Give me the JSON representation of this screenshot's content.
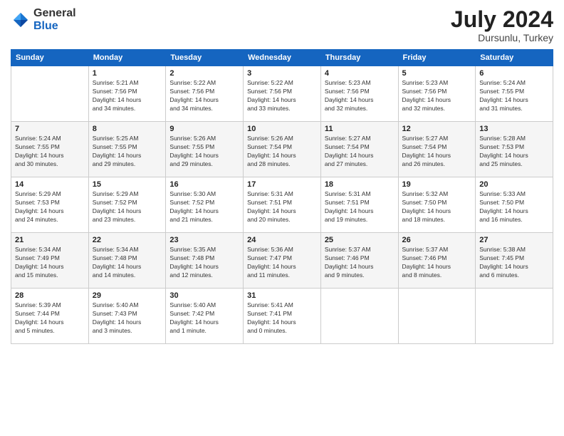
{
  "header": {
    "logo": {
      "general": "General",
      "blue": "Blue"
    },
    "title": "July 2024",
    "location": "Dursunlu, Turkey"
  },
  "days_of_week": [
    "Sunday",
    "Monday",
    "Tuesday",
    "Wednesday",
    "Thursday",
    "Friday",
    "Saturday"
  ],
  "weeks": [
    [
      {
        "day": "",
        "info": ""
      },
      {
        "day": "1",
        "info": "Sunrise: 5:21 AM\nSunset: 7:56 PM\nDaylight: 14 hours\nand 34 minutes."
      },
      {
        "day": "2",
        "info": "Sunrise: 5:22 AM\nSunset: 7:56 PM\nDaylight: 14 hours\nand 34 minutes."
      },
      {
        "day": "3",
        "info": "Sunrise: 5:22 AM\nSunset: 7:56 PM\nDaylight: 14 hours\nand 33 minutes."
      },
      {
        "day": "4",
        "info": "Sunrise: 5:23 AM\nSunset: 7:56 PM\nDaylight: 14 hours\nand 32 minutes."
      },
      {
        "day": "5",
        "info": "Sunrise: 5:23 AM\nSunset: 7:56 PM\nDaylight: 14 hours\nand 32 minutes."
      },
      {
        "day": "6",
        "info": "Sunrise: 5:24 AM\nSunset: 7:55 PM\nDaylight: 14 hours\nand 31 minutes."
      }
    ],
    [
      {
        "day": "7",
        "info": "Sunrise: 5:24 AM\nSunset: 7:55 PM\nDaylight: 14 hours\nand 30 minutes."
      },
      {
        "day": "8",
        "info": "Sunrise: 5:25 AM\nSunset: 7:55 PM\nDaylight: 14 hours\nand 29 minutes."
      },
      {
        "day": "9",
        "info": "Sunrise: 5:26 AM\nSunset: 7:55 PM\nDaylight: 14 hours\nand 29 minutes."
      },
      {
        "day": "10",
        "info": "Sunrise: 5:26 AM\nSunset: 7:54 PM\nDaylight: 14 hours\nand 28 minutes."
      },
      {
        "day": "11",
        "info": "Sunrise: 5:27 AM\nSunset: 7:54 PM\nDaylight: 14 hours\nand 27 minutes."
      },
      {
        "day": "12",
        "info": "Sunrise: 5:27 AM\nSunset: 7:54 PM\nDaylight: 14 hours\nand 26 minutes."
      },
      {
        "day": "13",
        "info": "Sunrise: 5:28 AM\nSunset: 7:53 PM\nDaylight: 14 hours\nand 25 minutes."
      }
    ],
    [
      {
        "day": "14",
        "info": "Sunrise: 5:29 AM\nSunset: 7:53 PM\nDaylight: 14 hours\nand 24 minutes."
      },
      {
        "day": "15",
        "info": "Sunrise: 5:29 AM\nSunset: 7:52 PM\nDaylight: 14 hours\nand 23 minutes."
      },
      {
        "day": "16",
        "info": "Sunrise: 5:30 AM\nSunset: 7:52 PM\nDaylight: 14 hours\nand 21 minutes."
      },
      {
        "day": "17",
        "info": "Sunrise: 5:31 AM\nSunset: 7:51 PM\nDaylight: 14 hours\nand 20 minutes."
      },
      {
        "day": "18",
        "info": "Sunrise: 5:31 AM\nSunset: 7:51 PM\nDaylight: 14 hours\nand 19 minutes."
      },
      {
        "day": "19",
        "info": "Sunrise: 5:32 AM\nSunset: 7:50 PM\nDaylight: 14 hours\nand 18 minutes."
      },
      {
        "day": "20",
        "info": "Sunrise: 5:33 AM\nSunset: 7:50 PM\nDaylight: 14 hours\nand 16 minutes."
      }
    ],
    [
      {
        "day": "21",
        "info": "Sunrise: 5:34 AM\nSunset: 7:49 PM\nDaylight: 14 hours\nand 15 minutes."
      },
      {
        "day": "22",
        "info": "Sunrise: 5:34 AM\nSunset: 7:48 PM\nDaylight: 14 hours\nand 14 minutes."
      },
      {
        "day": "23",
        "info": "Sunrise: 5:35 AM\nSunset: 7:48 PM\nDaylight: 14 hours\nand 12 minutes."
      },
      {
        "day": "24",
        "info": "Sunrise: 5:36 AM\nSunset: 7:47 PM\nDaylight: 14 hours\nand 11 minutes."
      },
      {
        "day": "25",
        "info": "Sunrise: 5:37 AM\nSunset: 7:46 PM\nDaylight: 14 hours\nand 9 minutes."
      },
      {
        "day": "26",
        "info": "Sunrise: 5:37 AM\nSunset: 7:46 PM\nDaylight: 14 hours\nand 8 minutes."
      },
      {
        "day": "27",
        "info": "Sunrise: 5:38 AM\nSunset: 7:45 PM\nDaylight: 14 hours\nand 6 minutes."
      }
    ],
    [
      {
        "day": "28",
        "info": "Sunrise: 5:39 AM\nSunset: 7:44 PM\nDaylight: 14 hours\nand 5 minutes."
      },
      {
        "day": "29",
        "info": "Sunrise: 5:40 AM\nSunset: 7:43 PM\nDaylight: 14 hours\nand 3 minutes."
      },
      {
        "day": "30",
        "info": "Sunrise: 5:40 AM\nSunset: 7:42 PM\nDaylight: 14 hours\nand 1 minute."
      },
      {
        "day": "31",
        "info": "Sunrise: 5:41 AM\nSunset: 7:41 PM\nDaylight: 14 hours\nand 0 minutes."
      },
      {
        "day": "",
        "info": ""
      },
      {
        "day": "",
        "info": ""
      },
      {
        "day": "",
        "info": ""
      }
    ]
  ]
}
